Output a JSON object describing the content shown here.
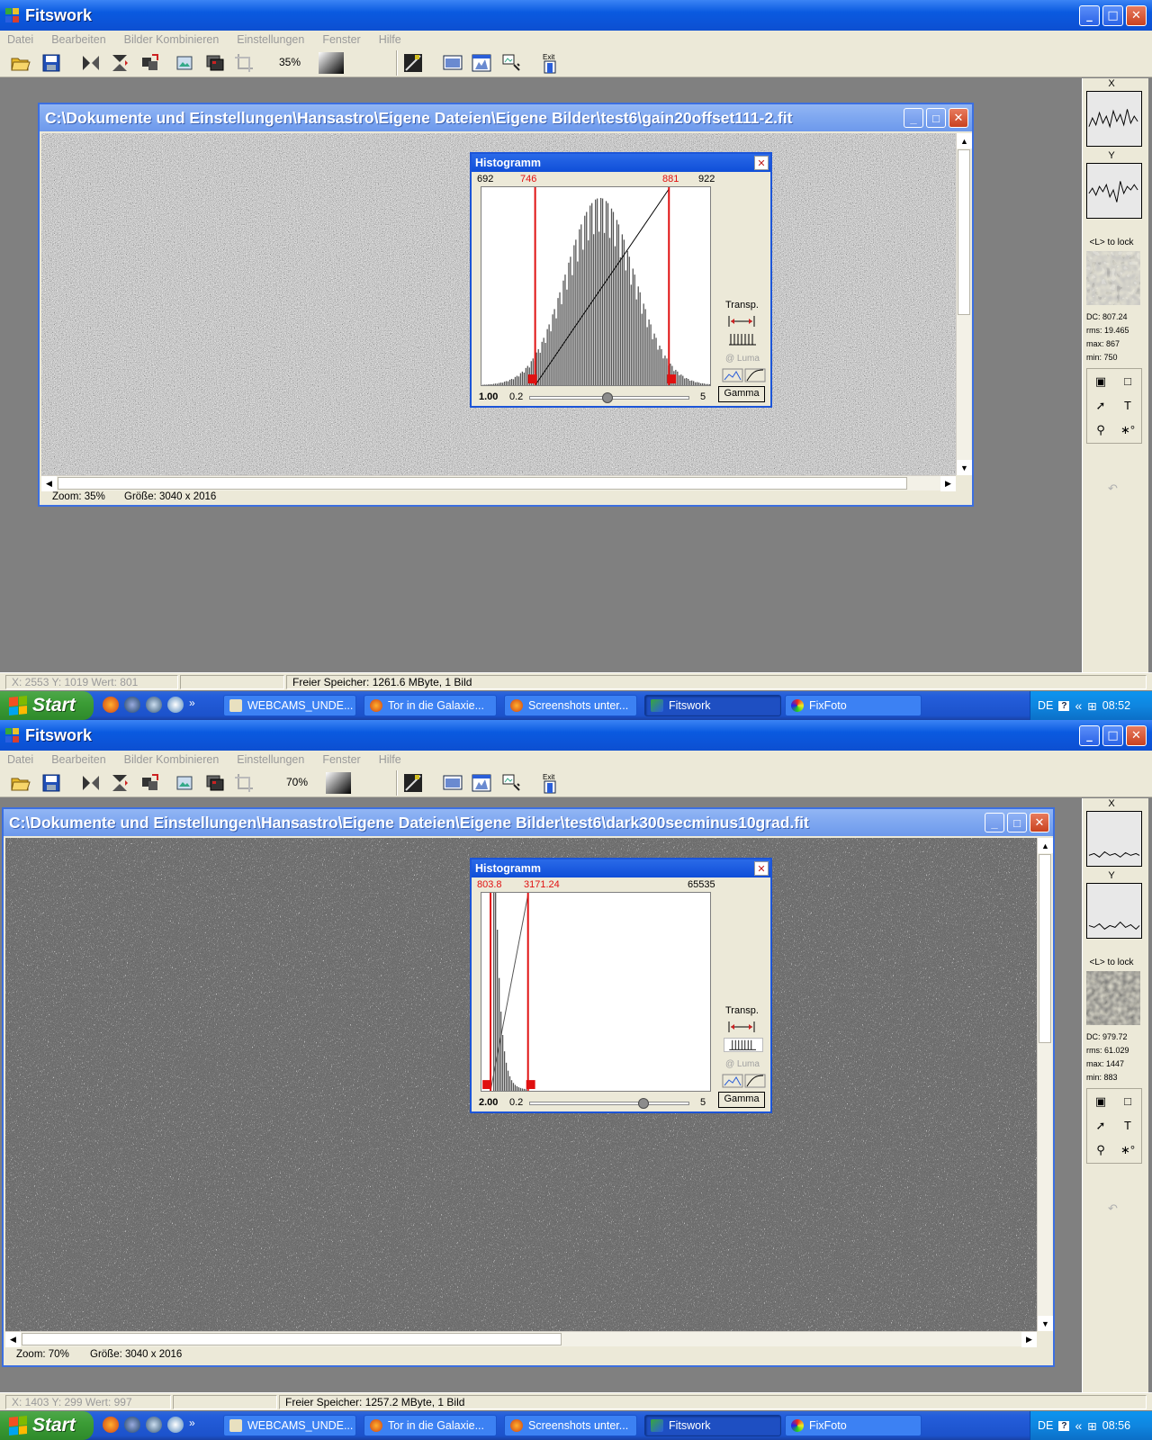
{
  "app": {
    "title": "Fitswork",
    "menu": [
      "Datei",
      "Bearbeiten",
      "Bilder Kombinieren",
      "Einstellungen",
      "Fenster",
      "Hilfe"
    ],
    "toolbar_exit_label": "Exit",
    "colors": {
      "xp_blue": "#0a5ae0",
      "hist_marker": "#e01010",
      "workspace_grey": "#808080"
    }
  },
  "top": {
    "zoom_select": "35%",
    "doc_title": "C:\\Dokumente und Einstellungen\\Hansastro\\Eigene Dateien\\Eigene Bilder\\test6\\gain20offset111-2.fit",
    "doc_status": {
      "zoom": "Zoom: 35%",
      "size": "Größe: 3040 x 2016"
    },
    "histogram": {
      "title": "Histogramm",
      "min": "692",
      "low": "746",
      "high": "881",
      "max": "922",
      "gamma_value": "1.00",
      "slider_min": "0.2",
      "slider_max": "5",
      "gamma_level": 0.48,
      "transp_label": "Transp.",
      "luma_label": "@ Luma",
      "gamma_button": "Gamma"
    },
    "panel": {
      "x_label": "X",
      "y_label": "Y",
      "lock_label": "<L> to lock",
      "dc": "DC: 807.24",
      "rms": "rms: 19.465",
      "max": "max: 867",
      "min": "min: 750"
    },
    "status": {
      "coords": "X: 2553  Y: 1019  Wert: 801",
      "memory": "Freier Speicher: 1261.6 MByte, 1 Bild"
    },
    "clock": "08:52"
  },
  "bottom": {
    "zoom_select": "70%",
    "doc_title": "C:\\Dokumente und Einstellungen\\Hansastro\\Eigene Dateien\\Eigene Bilder\\test6\\dark300secminus10grad.fit",
    "doc_status": {
      "zoom": "Zoom: 70%",
      "size": "Größe: 3040 x 2016"
    },
    "histogram": {
      "title": "Histogramm",
      "min": "",
      "low": "803.8",
      "high": "3171.24",
      "max": "65535",
      "gamma_value": "2.00",
      "slider_min": "0.2",
      "slider_max": "5",
      "gamma_level": 0.72,
      "transp_label": "Transp.",
      "luma_label": "@ Luma",
      "gamma_button": "Gamma"
    },
    "panel": {
      "x_label": "X",
      "y_label": "Y",
      "lock_label": "<L> to lock",
      "dc": "DC: 979.72",
      "rms": "rms: 61.029",
      "max": "max: 1447",
      "min": "min: 883"
    },
    "status": {
      "coords": "X: 1403  Y: 299  Wert: 997",
      "memory": "Freier Speicher: 1257.2 MByte, 1 Bild"
    },
    "clock": "08:56"
  },
  "taskbar": {
    "start": "Start",
    "more": "»",
    "lang": "DE",
    "tasks": [
      "WEBCAMS_UNDE...",
      "Tor in die Galaxie...",
      "Screenshots unter...",
      "Fitswork",
      "FixFoto"
    ],
    "task_icons": [
      "document-icon",
      "firefox-icon",
      "firefox-icon",
      "fitswork-icon",
      "fixfoto-icon"
    ],
    "active_task": "Fitswork"
  }
}
